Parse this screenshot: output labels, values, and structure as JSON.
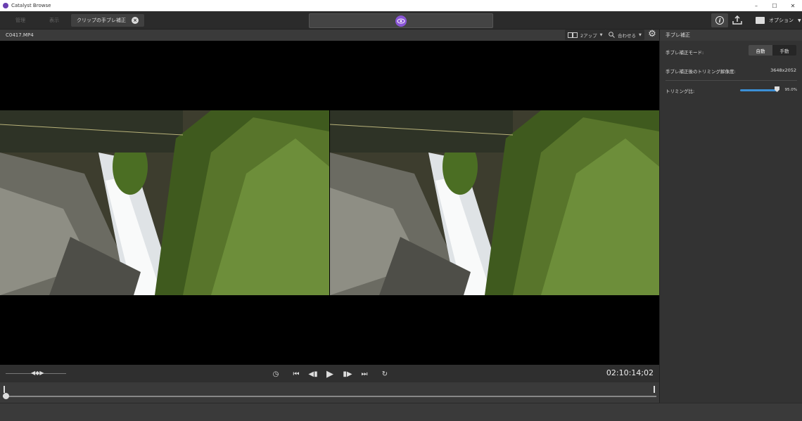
{
  "window": {
    "title": "Catalyst Browse",
    "minimize": "–",
    "maximize": "☐",
    "close": "✕"
  },
  "tabs": [
    {
      "label": "管理"
    },
    {
      "label": "表示"
    },
    {
      "label": "クリップの手ブレ補正"
    }
  ],
  "toolbar": {
    "options_label": "オプション"
  },
  "clip": {
    "filename": "C0417.MP4",
    "view_mode": "2アップ",
    "fit_label": "合わせる"
  },
  "playback": {
    "timecode": "02:10:14;02"
  },
  "panel": {
    "title": "手ブレ補正",
    "mode_label": "手ブレ補正モード:",
    "mode_options": [
      "自動",
      "手動"
    ],
    "mode_selected": "自動",
    "trim_res_label": "手ブレ補正後のトリミング解像度:",
    "trim_res_value": "3648x2052",
    "trim_ratio_label": "トリミング比:",
    "trim_ratio_value": "95.0%",
    "trim_ratio_fraction": 0.95
  },
  "colors": {
    "accent": "#8a55d6",
    "slider": "#3b8fd6"
  }
}
